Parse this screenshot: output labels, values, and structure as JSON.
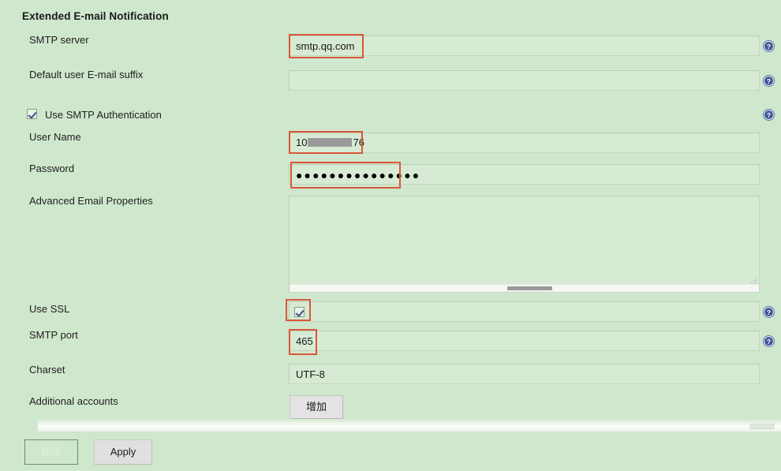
{
  "page": {
    "title": "Extended E-mail Notification",
    "background_color": "#cfe7cc",
    "annotation_color": "#d9573c"
  },
  "fields": {
    "smtp_server": {
      "label": "SMTP server",
      "value": "smtp.qq.com",
      "placeholder": "",
      "annotated": true,
      "help": true
    },
    "default_suffix": {
      "label": "Default user E-mail suffix",
      "value": "",
      "placeholder": "",
      "annotated": false,
      "help": true
    },
    "use_smtp_auth": {
      "label": "Use SMTP Authentication",
      "checked": true,
      "help": true
    },
    "user_name": {
      "label": "User Name",
      "value_prefix": "10",
      "value_suffix": "76",
      "redacted": true,
      "annotated": true,
      "help": false
    },
    "password": {
      "label": "Password",
      "value": "●●●●●●●●●●●●●●●",
      "annotated": true,
      "help": false
    },
    "advanced_properties": {
      "label": "Advanced Email Properties",
      "value": "",
      "placeholder": "",
      "annotated": false,
      "help": false
    },
    "use_ssl": {
      "label": "Use SSL",
      "checked": true,
      "annotated": true,
      "help": true
    },
    "smtp_port": {
      "label": "SMTP port",
      "value": "465",
      "annotated": true,
      "help": true
    },
    "charset": {
      "label": "Charset",
      "value": "UTF-8",
      "annotated": false,
      "help": false
    },
    "additional_accounts": {
      "label": "Additional accounts",
      "add_button_label": "增加"
    }
  },
  "footer": {
    "save_label": "保存",
    "apply_label": "Apply"
  },
  "icons": {
    "help": "help-question-circle-icon",
    "checkmark": "checkmark-icon",
    "resize": "resize-grip-icon"
  }
}
